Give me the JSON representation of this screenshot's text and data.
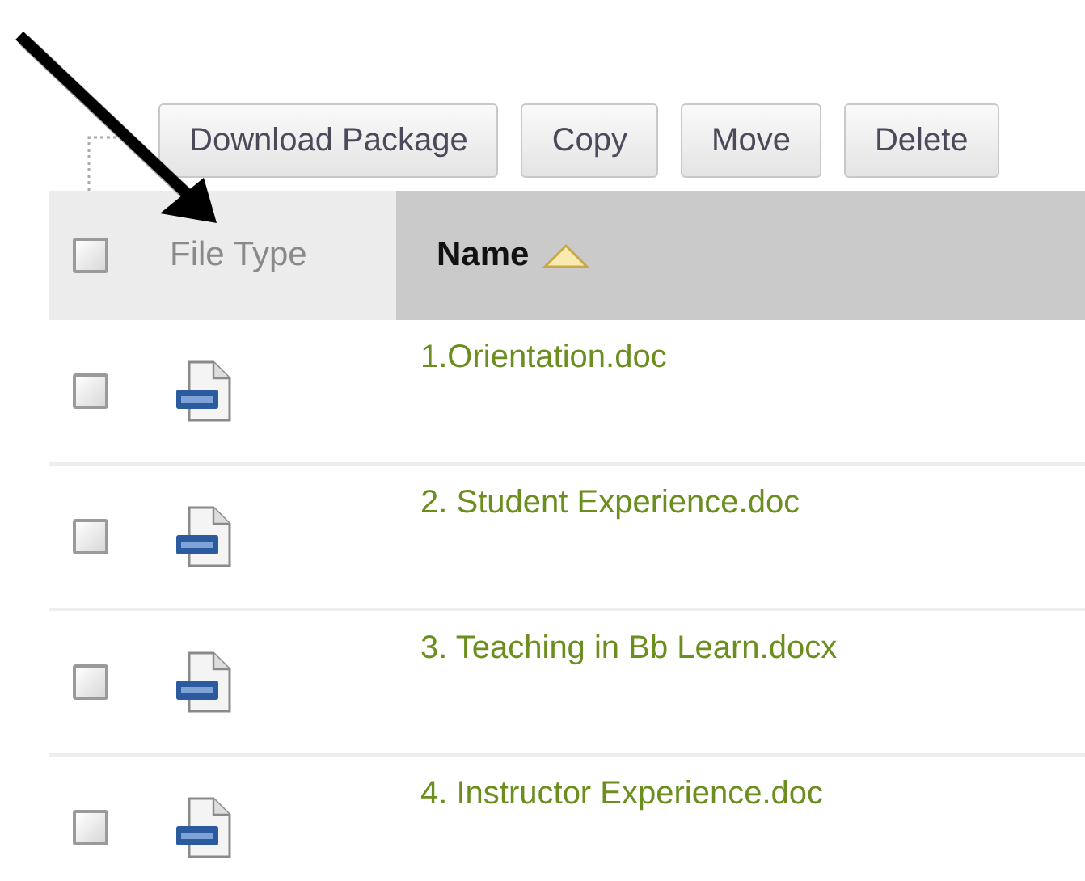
{
  "toolbar": {
    "buttons": [
      "Download Package",
      "Copy",
      "Move",
      "Delete"
    ]
  },
  "table": {
    "select_all": {
      "checked": false
    },
    "columns": [
      {
        "label": "File Type",
        "sorted": false
      },
      {
        "label": "Name",
        "sorted": true
      }
    ],
    "rows": [
      {
        "checked": false,
        "name": "1.Orientation.doc"
      },
      {
        "checked": false,
        "name": "2. Student Experience.doc"
      },
      {
        "checked": false,
        "name": "3. Teaching in Bb Learn.docx"
      },
      {
        "checked": false,
        "name": "4. Instructor Experience.doc"
      }
    ]
  }
}
